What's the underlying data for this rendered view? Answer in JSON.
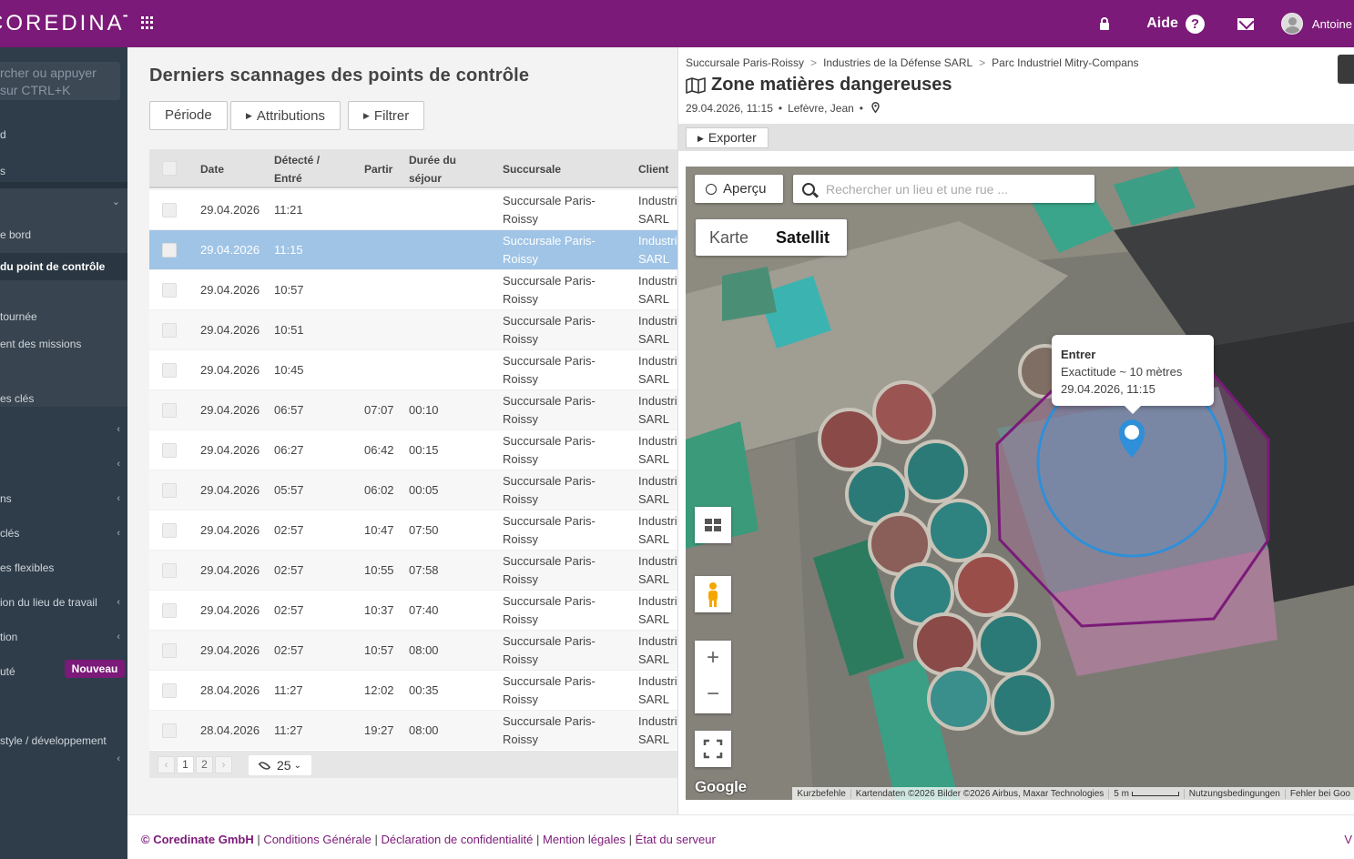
{
  "brand": "COREDINATE",
  "header": {
    "help_label": "Aide",
    "help_icon": "?",
    "user_name": "Antoine"
  },
  "sidebar": {
    "search_placeholder_line1": "rcher ou appuyer",
    "search_placeholder_line2": "sur CTRL+K",
    "items": [
      {
        "label": "d",
        "chevron": ""
      },
      {
        "label": "s",
        "chevron": ""
      },
      {
        "label": "",
        "chevron": "⌄"
      },
      {
        "label": "e bord",
        "chevron": ""
      },
      {
        "label": " du point de contrôle",
        "chevron": ""
      },
      {
        "label": "tournée",
        "chevron": ""
      },
      {
        "label": "ent des missions",
        "chevron": ""
      },
      {
        "label": "es clés",
        "chevron": ""
      },
      {
        "label": "",
        "chevron": "‹"
      },
      {
        "label": "",
        "chevron": "‹"
      },
      {
        "label": "ns",
        "chevron": "‹"
      },
      {
        "label": "clés",
        "chevron": "‹"
      },
      {
        "label": "es flexibles",
        "chevron": ""
      },
      {
        "label": "ion du lieu de travail",
        "chevron": "‹"
      },
      {
        "label": "tion",
        "chevron": "‹"
      },
      {
        "label": "uté",
        "chevron": ""
      },
      {
        "label": "style / développement",
        "chevron": ""
      },
      {
        "label": "",
        "chevron": "‹"
      }
    ],
    "new_badge": "Nouveau"
  },
  "main": {
    "title": "Derniers scannages des points de contrôle",
    "buttons": {
      "period": "Période",
      "attributions": "Attributions",
      "filter": "Filtrer"
    },
    "columns": {
      "date": "Date",
      "detected_1": "Détecté /",
      "detected_2": "Entré",
      "left": "Partir",
      "duration_1": "Durée du",
      "duration_2": "séjour",
      "branch": "Succursale",
      "client": "Client"
    },
    "rows": [
      {
        "date": "29.04.2026",
        "detected": "11:21",
        "left": "",
        "duration": "",
        "branch1": "Succursale Paris-",
        "branch2": "Roissy",
        "client1": "Industri",
        "client2": "SARL"
      },
      {
        "date": "29.04.2026",
        "detected": "11:15",
        "left": "",
        "duration": "",
        "branch1": "Succursale Paris-",
        "branch2": "Roissy",
        "client1": "Industri",
        "client2": "SARL"
      },
      {
        "date": "29.04.2026",
        "detected": "10:57",
        "left": "",
        "duration": "",
        "branch1": "Succursale Paris-",
        "branch2": "Roissy",
        "client1": "Industri",
        "client2": "SARL"
      },
      {
        "date": "29.04.2026",
        "detected": "10:51",
        "left": "",
        "duration": "",
        "branch1": "Succursale Paris-",
        "branch2": "Roissy",
        "client1": "Industri",
        "client2": "SARL"
      },
      {
        "date": "29.04.2026",
        "detected": "10:45",
        "left": "",
        "duration": "",
        "branch1": "Succursale Paris-",
        "branch2": "Roissy",
        "client1": "Industri",
        "client2": "SARL"
      },
      {
        "date": "29.04.2026",
        "detected": "06:57",
        "left": "07:07",
        "duration": "00:10",
        "branch1": "Succursale Paris-",
        "branch2": "Roissy",
        "client1": "Industri",
        "client2": "SARL"
      },
      {
        "date": "29.04.2026",
        "detected": "06:27",
        "left": "06:42",
        "duration": "00:15",
        "branch1": "Succursale Paris-",
        "branch2": "Roissy",
        "client1": "Industri",
        "client2": "SARL"
      },
      {
        "date": "29.04.2026",
        "detected": "05:57",
        "left": "06:02",
        "duration": "00:05",
        "branch1": "Succursale Paris-",
        "branch2": "Roissy",
        "client1": "Industri",
        "client2": "SARL"
      },
      {
        "date": "29.04.2026",
        "detected": "02:57",
        "left": "10:47",
        "duration": "07:50",
        "branch1": "Succursale Paris-",
        "branch2": "Roissy",
        "client1": "Industri",
        "client2": "SARL"
      },
      {
        "date": "29.04.2026",
        "detected": "02:57",
        "left": "10:55",
        "duration": "07:58",
        "branch1": "Succursale Paris-",
        "branch2": "Roissy",
        "client1": "Industri",
        "client2": "SARL"
      },
      {
        "date": "29.04.2026",
        "detected": "02:57",
        "left": "10:37",
        "duration": "07:40",
        "branch1": "Succursale Paris-",
        "branch2": "Roissy",
        "client1": "Industri",
        "client2": "SARL"
      },
      {
        "date": "29.04.2026",
        "detected": "02:57",
        "left": "10:57",
        "duration": "08:00",
        "branch1": "Succursale Paris-",
        "branch2": "Roissy",
        "client1": "Industri",
        "client2": "SARL"
      },
      {
        "date": "28.04.2026",
        "detected": "11:27",
        "left": "12:02",
        "duration": "00:35",
        "branch1": "Succursale Paris-",
        "branch2": "Roissy",
        "client1": "Industri",
        "client2": "SARL"
      },
      {
        "date": "28.04.2026",
        "detected": "11:27",
        "left": "19:27",
        "duration": "08:00",
        "branch1": "Succursale Paris-",
        "branch2": "Roissy",
        "client1": "Industri",
        "client2": "SARL"
      }
    ],
    "selected_row_index": 1,
    "pager": {
      "prev": "‹",
      "pages": [
        "1",
        "2"
      ],
      "next": "›",
      "per_page": "25"
    }
  },
  "detail": {
    "breadcrumb": [
      "Succursale Paris-Roissy",
      "Industries de la Défense SARL",
      "Parc Industriel Mitry-Compans"
    ],
    "title": "Zone matières dangereuses",
    "datetime": "29.04.2026, 11:15",
    "person": "Lefèvre, Jean",
    "export_label": "Exporter",
    "map": {
      "overview_label": "Aperçu",
      "search_placeholder": "Rechercher un lieu et une rue ...",
      "type_map": "Karte",
      "type_satellite": "Satellit",
      "tooltip_title": "Entrer",
      "tooltip_accuracy": "Exactitude ~ 10  mètres",
      "tooltip_time": "29.04.2026, 11:15",
      "google": "Google",
      "attribution": [
        "Kurzbefehle",
        "Kartendaten ©2026 Bilder ©2026 Airbus, Maxar Technologies",
        "5 m",
        "Nutzungsbedingungen",
        "Fehler bei Goo"
      ]
    }
  },
  "footer": {
    "copyright": "© Coredinate GmbH",
    "links": [
      "Conditions Générale",
      "Déclaration de confidentialité",
      "Mention légales",
      "État du serveur"
    ],
    "version": "V"
  },
  "colors": {
    "brand": "#7b1a78",
    "sidebar": "#2f3d4a",
    "selected_row": "#9fc4e6",
    "geofence": "#7b1a78",
    "marker": "#2f8fd8"
  }
}
